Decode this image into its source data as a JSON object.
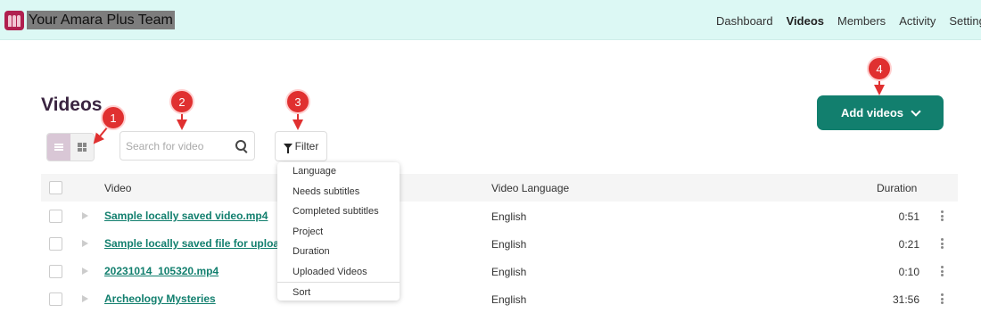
{
  "header": {
    "team_name": "Your Amara Plus Team",
    "nav": [
      {
        "label": "Dashboard",
        "active": false
      },
      {
        "label": "Videos",
        "active": true
      },
      {
        "label": "Members",
        "active": false
      },
      {
        "label": "Activity",
        "active": false
      },
      {
        "label": "Settings",
        "active": false
      }
    ]
  },
  "page": {
    "title": "Videos",
    "search_placeholder": "Search for video",
    "filter_label": "Filter",
    "add_button_label": "Add videos"
  },
  "table": {
    "columns": {
      "video": "Video",
      "language": "Video Language",
      "duration": "Duration"
    },
    "rows": [
      {
        "name": "Sample locally saved video.mp4",
        "language": "English",
        "duration": "0:51"
      },
      {
        "name": "Sample locally saved file for uploa..",
        "language": "English",
        "duration": "0:21"
      },
      {
        "name": "20231014_105320.mp4",
        "language": "English",
        "duration": "0:10"
      },
      {
        "name": "Archeology Mysteries",
        "language": "English",
        "duration": "31:56"
      }
    ]
  },
  "filter_menu": {
    "items": [
      "Language",
      "Needs subtitles",
      "Completed subtitles",
      "Project",
      "Duration",
      "Uploaded Videos"
    ],
    "sort_label": "Sort"
  },
  "callouts": [
    "1",
    "2",
    "3",
    "4"
  ],
  "colors": {
    "brand": "#127f6e",
    "header_bg": "#dcf8f4",
    "callout": "#e03030"
  }
}
